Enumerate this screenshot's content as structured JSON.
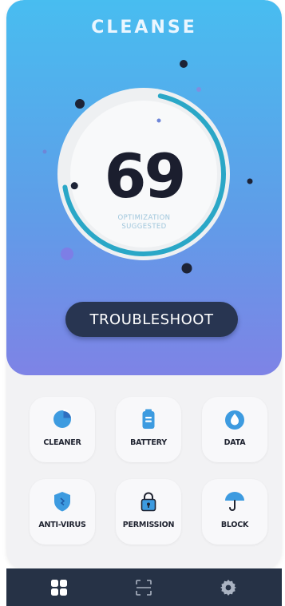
{
  "app": {
    "title": "CLEANSE"
  },
  "score": {
    "value": "69",
    "status_line1": "OPTIMIZATION",
    "status_line2": "SUGGESTED",
    "progress_percent": 69
  },
  "troubleshoot_label": "TROUBLESHOOT",
  "tiles": [
    {
      "label": "CLEANER",
      "icon": "pie-chart-icon"
    },
    {
      "label": "BATTERY",
      "icon": "battery-icon"
    },
    {
      "label": "DATA",
      "icon": "water-drop-icon"
    },
    {
      "label": "ANTI-VIRUS",
      "icon": "shield-icon"
    },
    {
      "label": "PERMISSION",
      "icon": "lock-icon"
    },
    {
      "label": "BLOCK",
      "icon": "umbrella-icon"
    }
  ],
  "nav": [
    {
      "name": "dashboard",
      "icon": "grid-icon",
      "active": true
    },
    {
      "name": "scan",
      "icon": "scan-icon",
      "active": false
    },
    {
      "name": "settings",
      "icon": "gear-icon",
      "active": false
    }
  ],
  "colors": {
    "hero_top": "#48bdf0",
    "hero_bottom": "#7e83e6",
    "arc": "#2aa7c7",
    "button_bg": "#283551",
    "icon_accent": "#3d9be0",
    "nav_bg": "#263246"
  }
}
